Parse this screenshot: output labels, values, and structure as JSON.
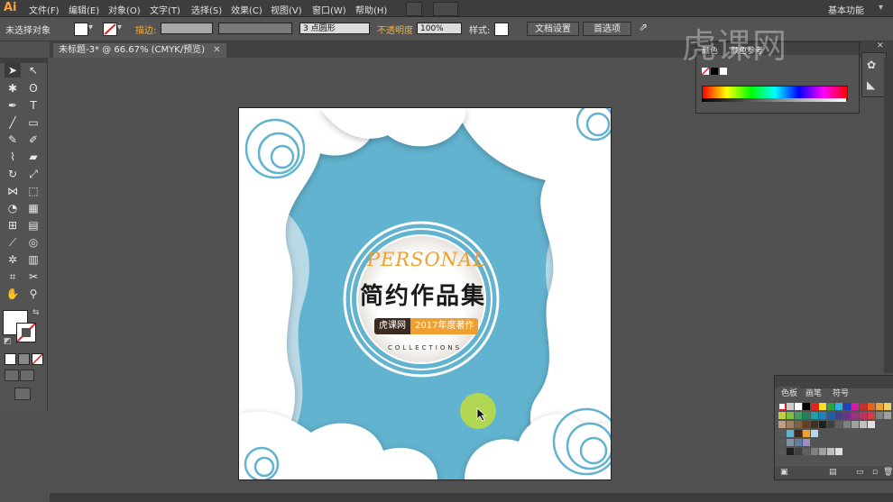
{
  "app": {
    "logo": "Ai",
    "workspace": "基本功能"
  },
  "menu": [
    "文件(F)",
    "编辑(E)",
    "对象(O)",
    "文字(T)",
    "选择(S)",
    "效果(C)",
    "视图(V)",
    "窗口(W)",
    "帮助(H)"
  ],
  "controlbar": {
    "selection": "未选择对象",
    "stroke_label": "描边:",
    "brush": "3 点圆形",
    "opacity_label": "不透明度",
    "opacity_value": "100%",
    "style_label": "样式:",
    "doc_settings": "文档设置",
    "preferences": "首选项"
  },
  "document": {
    "tab_title": "未标题-3* @ 66.67% (CMYK/预览)"
  },
  "color_panel": {
    "tabs": [
      "颜色",
      "颜色参考"
    ]
  },
  "swatches_panel": {
    "tabs": [
      "色板",
      "画笔",
      "符号"
    ]
  },
  "artwork": {
    "personal": "PERSONAL",
    "title": "简约作品集",
    "left_tag": "虎课网",
    "right_tag": "2017年度著作",
    "subtitle": "COLLECTIONS"
  },
  "watermark": "虎课网",
  "colors": {
    "sky": "#62b3cf",
    "sky_light": "#b9d9e6",
    "accent_orange": "#f0a030",
    "tag_brown": "#3b2a20",
    "ui_dark": "#3d3d3d",
    "ui_mid": "#535353"
  }
}
